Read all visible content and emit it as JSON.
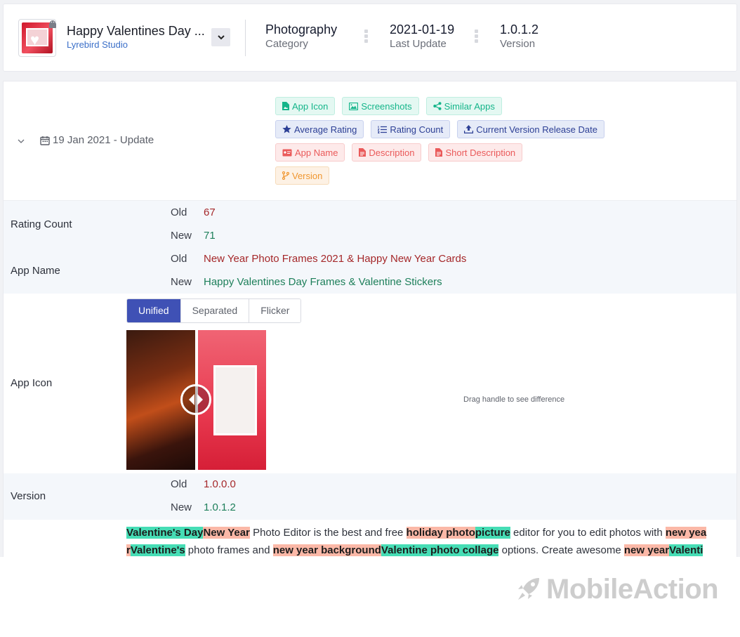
{
  "app": {
    "title": "Happy Valentines Day ...",
    "developer": "Lyrebird Studio"
  },
  "stats": [
    {
      "value": "Photography",
      "label": "Category"
    },
    {
      "value": "2021-01-19",
      "label": "Last Update"
    },
    {
      "value": "1.0.1.2",
      "label": "Version"
    }
  ],
  "update": {
    "date": "19 Jan 2021 - Update",
    "tags": {
      "app_icon": "App Icon",
      "screenshots": "Screenshots",
      "similar_apps": "Similar Apps",
      "average_rating": "Average Rating",
      "rating_count": "Rating Count",
      "current_version_release_date": "Current Version Release Date",
      "app_name": "App Name",
      "description": "Description",
      "short_description": "Short Description",
      "version": "Version"
    }
  },
  "labels": {
    "old": "Old",
    "new": "New"
  },
  "rating_count": {
    "label": "Rating Count",
    "old": "67",
    "new": "71"
  },
  "app_name": {
    "label": "App Name",
    "old": "New Year Photo Frames 2021 & Happy New Year Cards",
    "new": "Happy Valentines Day Frames & Valentine Stickers"
  },
  "app_icon": {
    "label": "App Icon",
    "tabs": [
      "Unified",
      "Separated",
      "Flicker"
    ],
    "active_tab": "Unified",
    "hint": "Drag handle to see difference"
  },
  "version": {
    "label": "Version",
    "old": "1.0.0.0",
    "new": "1.0.1.2"
  },
  "description": {
    "line1": [
      {
        "t": "Valentine's Day",
        "c": "g"
      },
      {
        "t": "New Year",
        "c": "r"
      },
      {
        "t": " Photo Editor is the best and free ",
        "c": ""
      },
      {
        "t": "holiday photo",
        "c": "r"
      },
      {
        "t": "picture",
        "c": "g"
      },
      {
        "t": " editor for you to edit photos with ",
        "c": ""
      },
      {
        "t": "new yea",
        "c": "r"
      }
    ],
    "line2": [
      {
        "t": "r",
        "c": "r"
      },
      {
        "t": "Valentine's",
        "c": "g"
      },
      {
        "t": " photo frames and ",
        "c": ""
      },
      {
        "t": "new year background",
        "c": "r"
      },
      {
        "t": "Valentine photo collage",
        "c": "g"
      },
      {
        "t": " options. Create awesome ",
        "c": ""
      },
      {
        "t": "new year",
        "c": "r"
      },
      {
        "t": "Valenti",
        "c": "g"
      }
    ]
  },
  "brand": {
    "name": "MobileAction"
  },
  "colors": {
    "accent": "#3f51b5",
    "old": "#a5282a",
    "new": "#1d7f5a",
    "removed_bg": "#fbb8a7",
    "added_bg": "#46ddb5"
  }
}
